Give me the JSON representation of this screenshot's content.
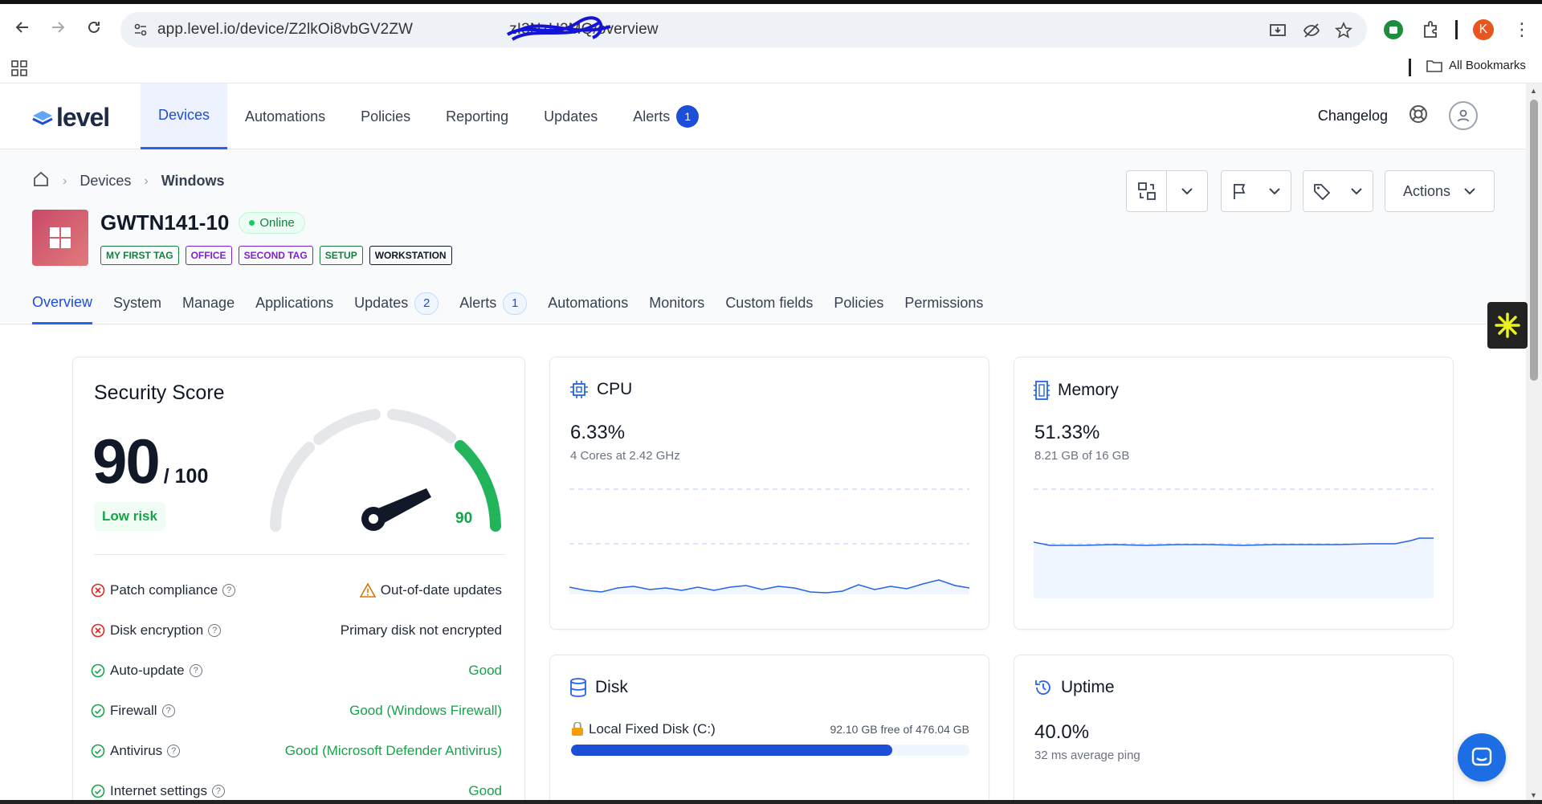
{
  "browser": {
    "url": "app.level.io/device/Z2lkOi8vbGV2ZW",
    "url_tail": "zI3NzU2MQ/overview",
    "all_bookmarks": "All Bookmarks",
    "profile_initial": "K"
  },
  "app": {
    "logo_text": "level",
    "nav": [
      {
        "label": "Devices",
        "active": true
      },
      {
        "label": "Automations"
      },
      {
        "label": "Policies"
      },
      {
        "label": "Reporting"
      },
      {
        "label": "Updates"
      },
      {
        "label": "Alerts",
        "badge": "1"
      }
    ],
    "changelog": "Changelog"
  },
  "breadcrumb": {
    "devices": "Devices",
    "current": "Windows"
  },
  "device": {
    "name": "GWTN141-10",
    "status": "Online",
    "tags": [
      {
        "label": "MY FIRST TAG",
        "color": "#15803d"
      },
      {
        "label": "OFFICE",
        "color": "#7e22ce"
      },
      {
        "label": "SECOND TAG",
        "color": "#7e22ce"
      },
      {
        "label": "SETUP",
        "color": "#15803d"
      },
      {
        "label": "WORKSTATION",
        "color": "#111827"
      }
    ]
  },
  "actions_label": "Actions",
  "tabs": [
    {
      "label": "Overview",
      "active": true
    },
    {
      "label": "System"
    },
    {
      "label": "Manage"
    },
    {
      "label": "Applications"
    },
    {
      "label": "Updates",
      "count": "2"
    },
    {
      "label": "Alerts",
      "count": "1"
    },
    {
      "label": "Automations"
    },
    {
      "label": "Monitors"
    },
    {
      "label": "Custom fields"
    },
    {
      "label": "Policies"
    },
    {
      "label": "Permissions"
    }
  ],
  "security": {
    "title": "Security Score",
    "score": "90",
    "max": "/ 100",
    "risk": "Low risk",
    "gauge_value": "90",
    "rows": [
      {
        "label": "Patch compliance",
        "status": "Out-of-date updates",
        "state": "bad"
      },
      {
        "label": "Disk encryption",
        "status": "Primary disk not encrypted",
        "state": "bad"
      },
      {
        "label": "Auto-update",
        "status": "Good",
        "state": "good"
      },
      {
        "label": "Firewall",
        "status": "Good (Windows Firewall)",
        "state": "good"
      },
      {
        "label": "Antivirus",
        "status": "Good (Microsoft Defender Antivirus)",
        "state": "good"
      },
      {
        "label": "Internet settings",
        "status": "Good",
        "state": "good"
      }
    ]
  },
  "cpu": {
    "title": "CPU",
    "value": "6.33%",
    "detail": "4 Cores at 2.42 GHz"
  },
  "memory": {
    "title": "Memory",
    "value": "51.33%",
    "detail": "8.21 GB of 16 GB"
  },
  "disk": {
    "title": "Disk",
    "name": "Local Fixed Disk (C:)",
    "free": "92.10 GB free of 476.04 GB",
    "used_fraction": 0.807
  },
  "uptime": {
    "title": "Uptime",
    "value": "40.0%",
    "detail": "32 ms average ping"
  }
}
